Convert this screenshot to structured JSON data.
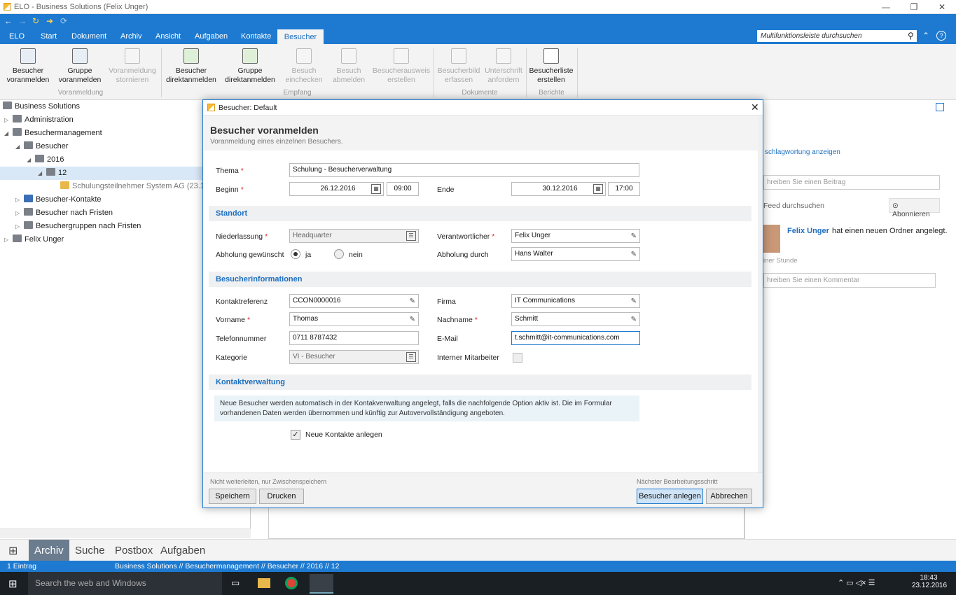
{
  "window": {
    "title": "ELO - Business Solutions (Felix Unger)"
  },
  "menu": {
    "tabs": [
      "ELO",
      "Start",
      "Dokument",
      "Archiv",
      "Ansicht",
      "Aufgaben",
      "Kontakte",
      "Besucher"
    ],
    "active": "Besucher",
    "search_placeholder": "Multifunktionsleiste durchsuchen"
  },
  "ribbon": {
    "buttons": [
      {
        "line1": "Besucher",
        "line2": "voranmelden",
        "enabled": true
      },
      {
        "line1": "Gruppe",
        "line2": "voranmelden",
        "enabled": true
      },
      {
        "line1": "Voranmeldung",
        "line2": "stornieren",
        "enabled": false
      },
      {
        "line1": "Besucher",
        "line2": "direktanmelden",
        "enabled": true
      },
      {
        "line1": "Gruppe",
        "line2": "direktanmelden",
        "enabled": true
      },
      {
        "line1": "Besuch",
        "line2": "einchecken",
        "enabled": false
      },
      {
        "line1": "Besuch",
        "line2": "abmelden",
        "enabled": false
      },
      {
        "line1": "Besucherausweis",
        "line2": "erstellen",
        "enabled": false
      },
      {
        "line1": "Besucherbild",
        "line2": "erfassen",
        "enabled": false
      },
      {
        "line1": "Unterschrift",
        "line2": "anfordern",
        "enabled": false
      },
      {
        "line1": "Besucherliste",
        "line2": "erstellen",
        "enabled": true
      }
    ],
    "groups": [
      "Voranmeldung",
      "Empfang",
      "Dokumente",
      "Berichte"
    ]
  },
  "tree": {
    "root": "Business Solutions",
    "items": [
      "Administration",
      "Besuchermanagement",
      "Besucher",
      "2016",
      "12",
      "Schulungsteilnehmer System AG (23.12.2",
      "Besucher-Kontakte",
      "Besucher nach Fristen",
      "Besuchergruppen nach Fristen",
      "Felix Unger"
    ]
  },
  "right": {
    "link": "schlagwortung anzeigen",
    "post_placeholder": "hreiben Sie einen Beitrag",
    "feed_search": "Feed durchsuchen",
    "subscribe": "Abonnieren",
    "user": "Felix Unger",
    "action": "hat einen neuen Ordner angelegt.",
    "time": "iner Stunde",
    "comment_placeholder": "hreiben Sie einen Kommentar"
  },
  "dialog": {
    "title": "Besucher: Default",
    "heading": "Besucher voranmelden",
    "subheading": "Voranmeldung eines einzelnen Besuchers.",
    "fields": {
      "thema_label": "Thema",
      "thema": "Schulung - Besucherverwaltung",
      "beginn_label": "Beginn",
      "beginn_date": "26.12.2016",
      "beginn_time": "09:00",
      "ende_label": "Ende",
      "ende_date": "30.12.2016",
      "ende_time": "17:00"
    },
    "standort": {
      "heading": "Standort",
      "niederlassung_label": "Niederlassung",
      "niederlassung": "Headquarter",
      "verantwortlicher_label": "Verantwortlicher",
      "verantwortlicher": "Felix Unger",
      "abholung_label": "Abholung gewünscht",
      "ja": "ja",
      "nein": "nein",
      "abholung_durch_label": "Abholung durch",
      "abholung_durch": "Hans Walter"
    },
    "info": {
      "heading": "Besucherinformationen",
      "kontaktreferenz_label": "Kontaktreferenz",
      "kontaktreferenz": "CCON0000016",
      "firma_label": "Firma",
      "firma": "IT Communications",
      "vorname_label": "Vorname",
      "vorname": "Thomas",
      "nachname_label": "Nachname",
      "nachname": "Schmitt",
      "telefon_label": "Telefonnummer",
      "telefon": "0711 8787432",
      "email_label": "E-Mail",
      "email": "t.schmitt@it-communications.com",
      "kategorie_label": "Kategorie",
      "kategorie": "VI - Besucher",
      "intern_label": "Interner Mitarbeiter"
    },
    "kontakt": {
      "heading": "Kontaktverwaltung",
      "note1": "Neue Besucher werden automatisch in der Kontakverwaltung angelegt, falls die nachfolgende Option aktiv ist. Die im Formular",
      "note2": "vorhandenen Daten werden übernommen und künftig zur Autovervollständigung angeboten.",
      "checkbox_label": "Neue Kontakte anlegen"
    },
    "footer": {
      "left_note": "Nicht weiterleiten, nur Zwischenspeichern",
      "right_note": "Nächster Bearbeitungsschritt",
      "save": "Speichern",
      "print": "Drucken",
      "create": "Besucher anlegen",
      "cancel": "Abbrechen"
    }
  },
  "bottomnav": [
    "Archiv",
    "Suche",
    "Postbox",
    "Aufgaben"
  ],
  "status": {
    "left": "1 Eintrag",
    "path": "Business Solutions // Besuchermanagement // Besucher // 2016 // 12"
  },
  "taskbar": {
    "search": "Search the web and Windows",
    "time": "18:43",
    "date": "23.12.2016"
  }
}
